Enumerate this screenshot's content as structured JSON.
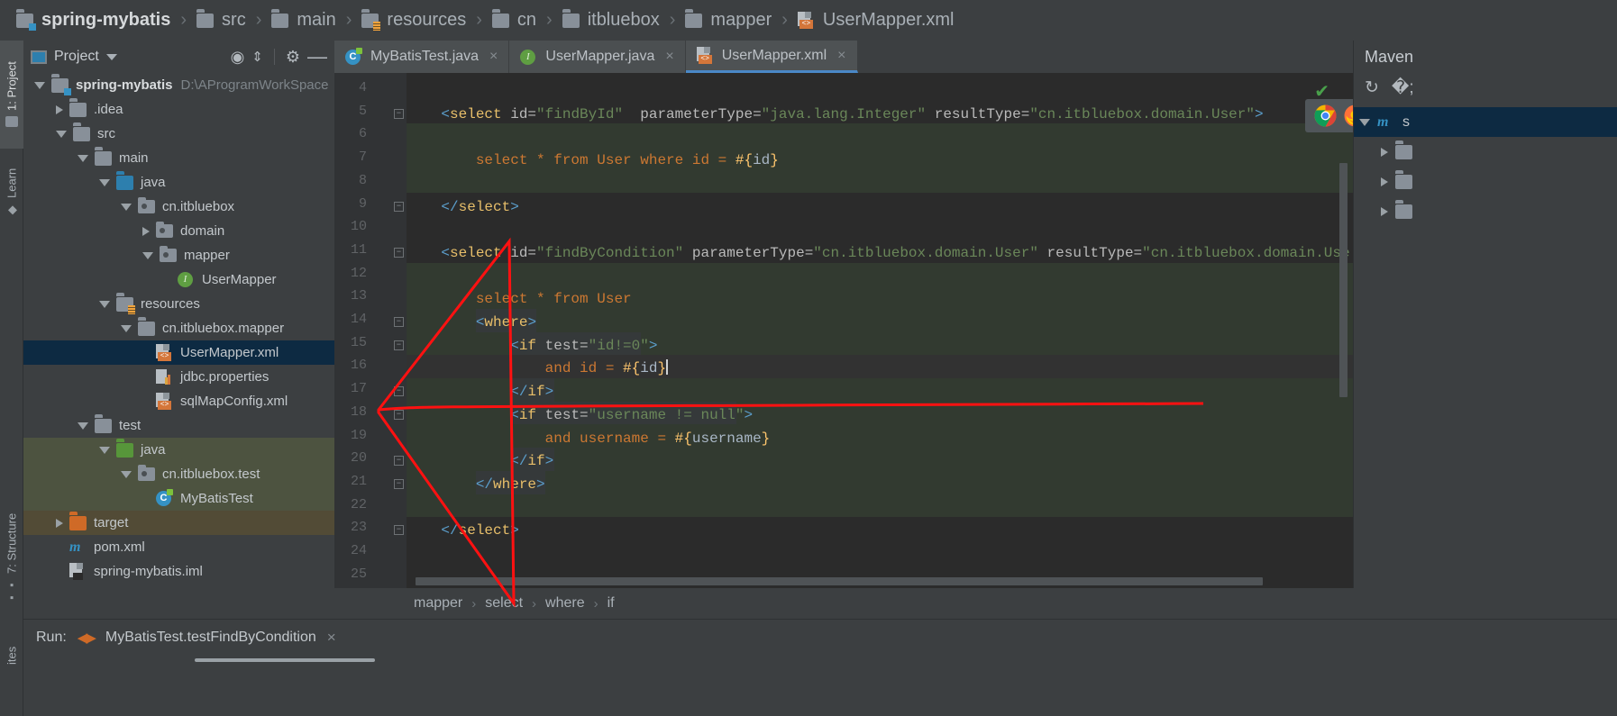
{
  "breadcrumb_top": {
    "items": [
      {
        "label": "spring-mybatis",
        "icon": "module-folder-icon"
      },
      {
        "label": "src",
        "icon": "folder-icon"
      },
      {
        "label": "main",
        "icon": "folder-icon"
      },
      {
        "label": "resources",
        "icon": "resources-folder-icon"
      },
      {
        "label": "cn",
        "icon": "folder-icon"
      },
      {
        "label": "itbluebox",
        "icon": "folder-icon"
      },
      {
        "label": "mapper",
        "icon": "folder-icon"
      },
      {
        "label": "UserMapper.xml",
        "icon": "xml-file-icon"
      }
    ],
    "separator": "›"
  },
  "left_strip": {
    "tabs": [
      {
        "label": "1: Project",
        "icon": "project-folder-icon",
        "active": true
      },
      {
        "label": "Learn",
        "icon": "graduation-cap-icon",
        "active": false
      },
      {
        "label": "7: Structure",
        "icon": "structure-icon",
        "active": false
      },
      {
        "label": "ites",
        "icon": "favorites-icon",
        "active": false
      }
    ]
  },
  "project_panel": {
    "title": "Project",
    "icons": {
      "window": "project-view-icon",
      "dropdown": "chevron-down-icon",
      "locate": "locate-target-icon",
      "collapse": "collapse-all-icon",
      "settings": "gear-icon",
      "hide": "minimize-icon"
    },
    "tree": [
      {
        "label": "spring-mybatis",
        "path": "D:\\AProgramWorkSpace",
        "indent": 0,
        "arrow": "down",
        "icon": "module-folder-icon",
        "bold": true,
        "state": "none"
      },
      {
        "label": ".idea",
        "path": "",
        "indent": 1,
        "arrow": "right",
        "icon": "folder-icon",
        "bold": false,
        "state": "none"
      },
      {
        "label": "src",
        "path": "",
        "indent": 1,
        "arrow": "down",
        "icon": "folder-icon",
        "bold": false,
        "state": "none"
      },
      {
        "label": "main",
        "path": "",
        "indent": 2,
        "arrow": "down",
        "icon": "folder-icon",
        "bold": false,
        "state": "none"
      },
      {
        "label": "java",
        "path": "",
        "indent": 3,
        "arrow": "down",
        "icon": "source-folder-icon",
        "bold": false,
        "state": "none"
      },
      {
        "label": "cn.itbluebox",
        "path": "",
        "indent": 4,
        "arrow": "down",
        "icon": "package-icon",
        "bold": false,
        "state": "none"
      },
      {
        "label": "domain",
        "path": "",
        "indent": 5,
        "arrow": "right",
        "icon": "package-icon",
        "bold": false,
        "state": "none"
      },
      {
        "label": "mapper",
        "path": "",
        "indent": 5,
        "arrow": "down",
        "icon": "package-icon",
        "bold": false,
        "state": "none"
      },
      {
        "label": "UserMapper",
        "path": "",
        "indent": 6,
        "arrow": "none",
        "icon": "interface-icon",
        "bold": false,
        "state": "none"
      },
      {
        "label": "resources",
        "path": "",
        "indent": 3,
        "arrow": "down",
        "icon": "resources-folder-icon",
        "bold": false,
        "state": "none"
      },
      {
        "label": "cn.itbluebox.mapper",
        "path": "",
        "indent": 4,
        "arrow": "down",
        "icon": "folder-icon",
        "bold": false,
        "state": "none"
      },
      {
        "label": "UserMapper.xml",
        "path": "",
        "indent": 5,
        "arrow": "none",
        "icon": "xml-file-icon",
        "bold": false,
        "state": "selected"
      },
      {
        "label": "jdbc.properties",
        "path": "",
        "indent": 5,
        "arrow": "none",
        "icon": "properties-file-icon",
        "bold": false,
        "state": "none"
      },
      {
        "label": "sqlMapConfig.xml",
        "path": "",
        "indent": 5,
        "arrow": "none",
        "icon": "xml-file-icon",
        "bold": false,
        "state": "none"
      },
      {
        "label": "test",
        "path": "",
        "indent": 2,
        "arrow": "down",
        "icon": "folder-icon",
        "bold": false,
        "state": "none"
      },
      {
        "label": "java",
        "path": "",
        "indent": 3,
        "arrow": "down",
        "icon": "test-source-folder-icon",
        "bold": false,
        "state": "testroot"
      },
      {
        "label": "cn.itbluebox.test",
        "path": "",
        "indent": 4,
        "arrow": "down",
        "icon": "package-icon",
        "bold": false,
        "state": "testroot"
      },
      {
        "label": "MyBatisTest",
        "path": "",
        "indent": 5,
        "arrow": "none",
        "icon": "test-class-icon",
        "bold": false,
        "state": "testroot"
      },
      {
        "label": "target",
        "path": "",
        "indent": 1,
        "arrow": "right",
        "icon": "excluded-folder-icon",
        "bold": false,
        "state": "targetrow"
      },
      {
        "label": "pom.xml",
        "path": "",
        "indent": 1,
        "arrow": "none",
        "icon": "maven-icon",
        "bold": false,
        "state": "none"
      },
      {
        "label": "spring-mybatis.iml",
        "path": "",
        "indent": 1,
        "arrow": "none",
        "icon": "iml-file-icon",
        "bold": false,
        "state": "none"
      }
    ]
  },
  "editor_tabs": [
    {
      "label": "MyBatisTest.java",
      "icon": "test-class-icon",
      "active": false,
      "close": "×"
    },
    {
      "label": "UserMapper.java",
      "icon": "interface-icon",
      "active": false,
      "close": "×"
    },
    {
      "label": "UserMapper.xml",
      "icon": "xml-file-icon",
      "active": true,
      "close": "×"
    }
  ],
  "editor": {
    "first_line": 4,
    "last_line": 25,
    "inspection_status": "✔",
    "lines": [
      {
        "n": 4,
        "tokens": []
      },
      {
        "n": 5,
        "fold": "minus",
        "tokens": [
          {
            "t": "    ",
            "c": "plain"
          },
          {
            "t": "<",
            "c": "brack"
          },
          {
            "t": "select",
            "c": "tag"
          },
          {
            "t": " id=",
            "c": "attr"
          },
          {
            "t": "\"findById\"",
            "c": "str"
          },
          {
            "t": "  parameterType=",
            "c": "attr"
          },
          {
            "t": "\"java.lang.Integer\"",
            "c": "str"
          },
          {
            "t": " resultType=",
            "c": "attr"
          },
          {
            "t": "\"cn.itbluebox.domain.User\"",
            "c": "str"
          },
          {
            "t": ">",
            "c": "brack"
          }
        ]
      },
      {
        "n": 6,
        "tokens": []
      },
      {
        "n": 7,
        "tokens": [
          {
            "t": "        select * from User where id = ",
            "c": "sql"
          },
          {
            "t": "#{",
            "c": "param"
          },
          {
            "t": "id",
            "c": "plain"
          },
          {
            "t": "}",
            "c": "param"
          }
        ]
      },
      {
        "n": 8,
        "tokens": []
      },
      {
        "n": 9,
        "fold": "minus",
        "tokens": [
          {
            "t": "    ",
            "c": "plain"
          },
          {
            "t": "</",
            "c": "brack"
          },
          {
            "t": "select",
            "c": "tag"
          },
          {
            "t": ">",
            "c": "brack"
          }
        ]
      },
      {
        "n": 10,
        "tokens": []
      },
      {
        "n": 11,
        "fold": "minus",
        "tokens": [
          {
            "t": "    ",
            "c": "plain"
          },
          {
            "t": "<",
            "c": "brack"
          },
          {
            "t": "select",
            "c": "tag"
          },
          {
            "t": " id=",
            "c": "attr"
          },
          {
            "t": "\"findByCondition\"",
            "c": "str"
          },
          {
            "t": " parameterType=",
            "c": "attr"
          },
          {
            "t": "\"cn.itbluebox.domain.User\"",
            "c": "str"
          },
          {
            "t": " resultType=",
            "c": "attr"
          },
          {
            "t": "\"cn.itbluebox.domain.Use",
            "c": "str"
          }
        ]
      },
      {
        "n": 12,
        "tokens": []
      },
      {
        "n": 13,
        "tokens": [
          {
            "t": "        select * from User",
            "c": "sql"
          }
        ]
      },
      {
        "n": 14,
        "fold": "minus",
        "tokens": [
          {
            "t": "        ",
            "c": "plain"
          },
          {
            "t": "<",
            "c": "brack"
          },
          {
            "t": "where",
            "c": "tag"
          },
          {
            "t": ">",
            "c": "brack"
          }
        ]
      },
      {
        "n": 15,
        "fold": "minus",
        "tokens": [
          {
            "t": "            ",
            "c": "plain"
          },
          {
            "t": "<",
            "c": "brack"
          },
          {
            "t": "if",
            "c": "tag"
          },
          {
            "t": " test=",
            "c": "attr"
          },
          {
            "t": "\"id!=0\"",
            "c": "str"
          },
          {
            "t": ">",
            "c": "brack"
          }
        ]
      },
      {
        "n": 16,
        "current": true,
        "tokens": [
          {
            "t": "                and id = ",
            "c": "sql"
          },
          {
            "t": "#{",
            "c": "param"
          },
          {
            "t": "id",
            "c": "plain"
          },
          {
            "t": "}",
            "c": "param"
          }
        ]
      },
      {
        "n": 17,
        "fold": "minus",
        "tokens": [
          {
            "t": "            ",
            "c": "plain"
          },
          {
            "t": "</",
            "c": "brack"
          },
          {
            "t": "if",
            "c": "tag"
          },
          {
            "t": ">",
            "c": "brack"
          }
        ]
      },
      {
        "n": 18,
        "fold": "minus",
        "tokens": [
          {
            "t": "            ",
            "c": "plain"
          },
          {
            "t": "<",
            "c": "brack"
          },
          {
            "t": "if",
            "c": "tag"
          },
          {
            "t": " test=",
            "c": "attr"
          },
          {
            "t": "\"username != null\"",
            "c": "str"
          },
          {
            "t": ">",
            "c": "brack"
          }
        ]
      },
      {
        "n": 19,
        "tokens": [
          {
            "t": "                and username = ",
            "c": "sql"
          },
          {
            "t": "#{",
            "c": "param"
          },
          {
            "t": "username",
            "c": "plain"
          },
          {
            "t": "}",
            "c": "param"
          }
        ]
      },
      {
        "n": 20,
        "fold": "minus",
        "tokens": [
          {
            "t": "            ",
            "c": "plain"
          },
          {
            "t": "</",
            "c": "brack"
          },
          {
            "t": "if",
            "c": "tag"
          },
          {
            "t": ">",
            "c": "brack"
          }
        ]
      },
      {
        "n": 21,
        "fold": "minus",
        "tokens": [
          {
            "t": "        ",
            "c": "plain"
          },
          {
            "t": "</",
            "c": "brack"
          },
          {
            "t": "where",
            "c": "tag"
          },
          {
            "t": ">",
            "c": "brack"
          }
        ]
      },
      {
        "n": 22,
        "tokens": []
      },
      {
        "n": 23,
        "fold": "minus",
        "tokens": [
          {
            "t": "    ",
            "c": "plain"
          },
          {
            "t": "</",
            "c": "brack"
          },
          {
            "t": "select",
            "c": "tag"
          },
          {
            "t": ">",
            "c": "brack"
          }
        ]
      },
      {
        "n": 24,
        "tokens": []
      },
      {
        "n": 25,
        "tokens": []
      }
    ]
  },
  "browser_popup": {
    "browsers": [
      {
        "name": "chrome-icon"
      },
      {
        "name": "firefox-icon"
      },
      {
        "name": "safari-icon"
      },
      {
        "name": "opera-icon"
      },
      {
        "name": "internet-explorer-icon"
      },
      {
        "name": "edge-icon"
      }
    ]
  },
  "editor_breadcrumb": {
    "items": [
      "mapper",
      "select",
      "where",
      "if"
    ],
    "separator": "›"
  },
  "maven_panel": {
    "title": "Maven",
    "icons": {
      "refresh": "refresh-icon",
      "download": "download-sources-icon"
    },
    "rows": [
      {
        "label": "s",
        "icon": "maven-project-icon",
        "arrow": "down",
        "selected": true
      },
      {
        "label": "",
        "icon": "folder-icon",
        "arrow": "right",
        "selected": false
      },
      {
        "label": "",
        "icon": "folder-icon",
        "arrow": "right",
        "selected": false
      },
      {
        "label": "",
        "icon": "folder-icon",
        "arrow": "right",
        "selected": false
      }
    ]
  },
  "run_panel": {
    "label": "Run:",
    "config_name": "MyBatisTest.testFindByCondition",
    "close": "×",
    "icon": "run-config-icon"
  },
  "colors": {
    "accent_blue": "#4a88c7",
    "selection": "#0d2a42",
    "sql_orange": "#cc7832",
    "string_green": "#6a8759",
    "tag_yellow": "#e8bf6a",
    "annotation_red": "#ff1111"
  }
}
